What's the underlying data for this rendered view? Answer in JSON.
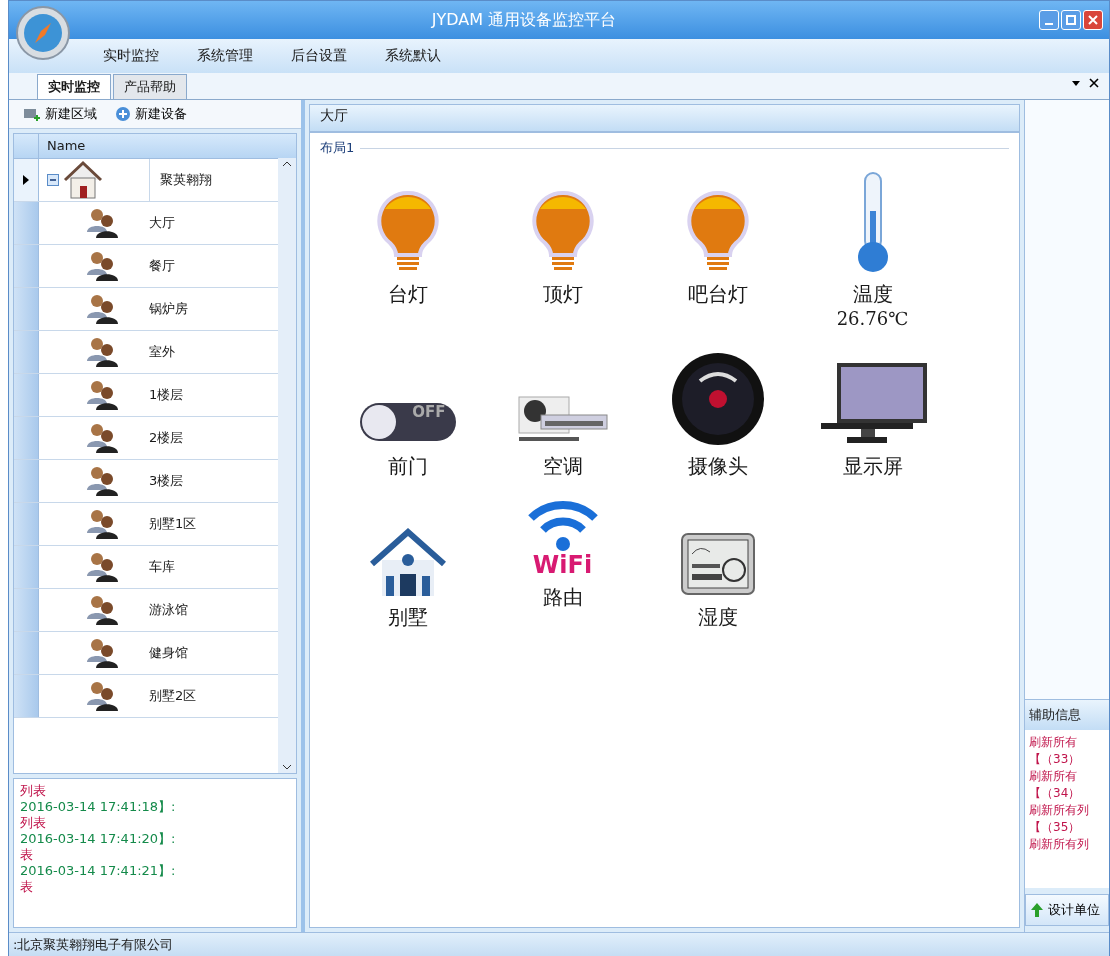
{
  "window": {
    "title": "JYDAM 通用设备监控平台"
  },
  "menu": [
    "实时监控",
    "系统管理",
    "后台设置",
    "系统默认"
  ],
  "tabs": [
    {
      "label": "实时监控",
      "selected": true
    },
    {
      "label": "产品帮助",
      "selected": false
    }
  ],
  "toolbar": [
    {
      "kind": "area",
      "label": "新建区域"
    },
    {
      "kind": "device",
      "label": "新建设备"
    }
  ],
  "tree": {
    "column": "Name",
    "nodes": [
      {
        "label": "聚英翱翔",
        "selected": true,
        "expanded": true,
        "children": [
          {
            "label": "大厅",
            "selected": false
          },
          {
            "label": "餐厅",
            "selected": false
          },
          {
            "label": "锅炉房",
            "selected": false
          },
          {
            "label": "室外",
            "selected": false
          },
          {
            "label": "1楼层",
            "selected": false
          },
          {
            "label": "2楼层",
            "selected": false
          },
          {
            "label": "3楼层",
            "selected": false
          },
          {
            "label": "别墅1区",
            "selected": false
          },
          {
            "label": "车库",
            "selected": false
          },
          {
            "label": "游泳馆",
            "selected": false
          },
          {
            "label": "健身馆",
            "selected": false
          },
          {
            "label": "别墅2区",
            "selected": false
          }
        ]
      }
    ]
  },
  "log_left": [
    "列表",
    "2016-03-14 17:41:18】:",
    "列表",
    "2016-03-14 17:41:20】:",
    "表",
    "2016-03-14 17:41:21】:",
    "表"
  ],
  "main": {
    "title": "大厅",
    "group": "布局1",
    "devices": [
      {
        "kind": "bulb",
        "label": "台灯"
      },
      {
        "kind": "bulb",
        "label": "顶灯"
      },
      {
        "kind": "bulb",
        "label": "吧台灯"
      },
      {
        "kind": "thermometer",
        "label": "温度",
        "reading": "26.76℃"
      },
      {
        "kind": "switch",
        "label": "前门",
        "on": false,
        "switch_text": "OFF"
      },
      {
        "kind": "ac",
        "label": "空调"
      },
      {
        "kind": "camera",
        "label": "摄像头"
      },
      {
        "kind": "monitor",
        "label": "显示屏"
      },
      {
        "kind": "house",
        "label": "别墅"
      },
      {
        "kind": "wifi",
        "label": "路由",
        "icon_text": "WiFi"
      },
      {
        "kind": "station",
        "label": "湿度"
      }
    ]
  },
  "side": {
    "title": "辅助信息",
    "log": [
      "刷新所有",
      "【（33）",
      "刷新所有",
      "【（34）",
      "刷新所有列",
      "【（35）",
      "刷新所有列"
    ],
    "button": "设计单位"
  },
  "status_bar": ":北京聚英翱翔电子有限公司"
}
